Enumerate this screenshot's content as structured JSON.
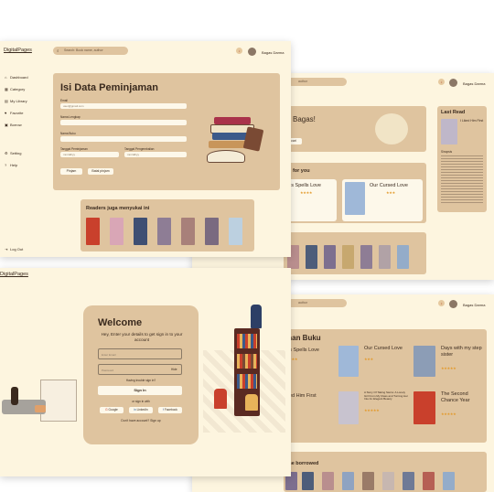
{
  "brand": "DigitalPages",
  "search_placeholder": "Search: Book name, author",
  "search_placeholder_short": "author",
  "user_name": "Bagas Darma",
  "sidebar": {
    "items": [
      "Dashboard",
      "Category",
      "My Library",
      "Favorite",
      "Borrow"
    ],
    "bottom_items": [
      "Setting",
      "Help"
    ],
    "logout": "Log Out"
  },
  "form": {
    "title": "Isi Data Peminjaman",
    "email_label": "Email",
    "email_placeholder": "user@gmail.com",
    "name_label": "Nama Lengkap",
    "book_label": "Nama Buku",
    "borrow_date_label": "Tanggal Peminjaman",
    "return_date_label": "Tanggal Pengembalian",
    "borrow_date_value": "mm/dd/yy",
    "return_date_value": "mm/dd/yy",
    "submit": "Pinjam",
    "cancel": "Batal pinjam"
  },
  "readers": {
    "title": "Readers juga menyukai ini"
  },
  "dashboard": {
    "greeting": "Bagas!",
    "button": "cari",
    "for_you": "ed for you",
    "last_read": "Last Read",
    "last_read_title": "I Liked Him First",
    "last_read_label_1": "Sinopsis",
    "card1_title": "his Spells Love",
    "card2_title": "Our Cursed Love"
  },
  "category_page": {
    "title": "man Buku",
    "books": [
      {
        "title": "his Spells Love"
      },
      {
        "title": "Our Cursed Love"
      },
      {
        "title": "Days with my step sister"
      },
      {
        "title": "iked Him First"
      },
      {
        "title": "A Story Of Taking Sierra: A Lonely Girl From My Class and Turning Her Into An Elegant Beauty"
      },
      {
        "title": "The Second Chance Year"
      }
    ],
    "borrowed": "one borrowed"
  },
  "login": {
    "title": "Welcome",
    "subtitle": "Hey, Enter your details to get sign in to your account",
    "email_placeholder": "Enter Email",
    "password_placeholder": "Password",
    "hide": "Hide",
    "trouble": "Having trouble sign in?",
    "signin": "Sign In",
    "or": "or sign in with",
    "google": "Google",
    "linkedin": "LinkedIn",
    "facebook": "Facebook",
    "signup": "Don't have account? Sign up"
  },
  "colors": {
    "page_bg": "#fdf5df",
    "panel": "#dfc49f",
    "field": "#fdf8ea",
    "accent_star": "#e39a2b"
  }
}
